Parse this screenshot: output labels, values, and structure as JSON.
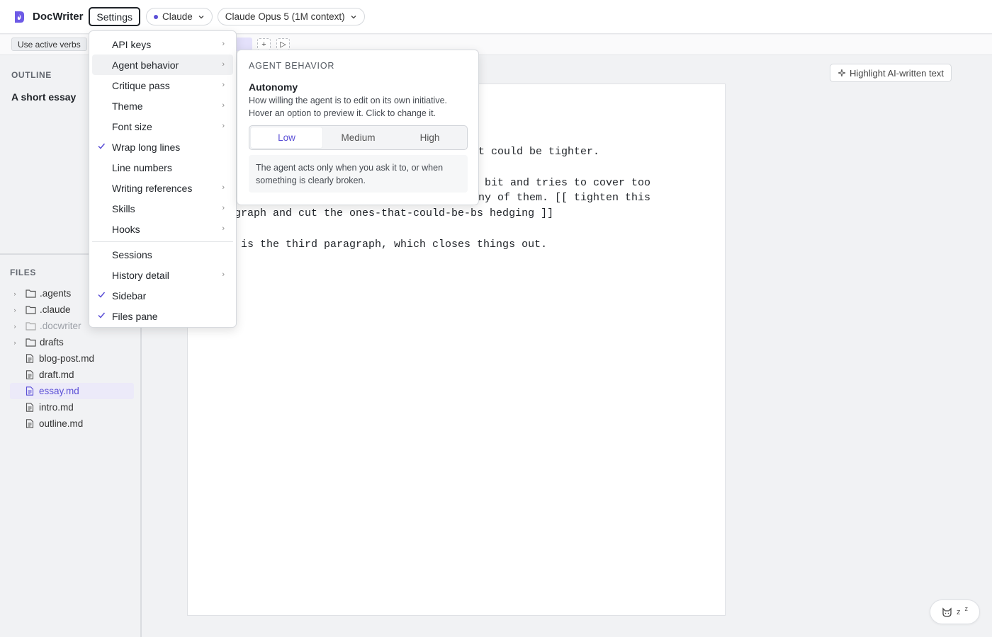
{
  "header": {
    "app_title": "DocWriter",
    "settings_label": "Settings",
    "provider_label": "Claude",
    "model_label": "Claude Opus 5 (1M context)"
  },
  "toolbar": {
    "chip_label": "Use active verbs",
    "add_label": "+",
    "play_label": "▷"
  },
  "sidebar": {
    "outline_label": "OUTLINE",
    "outline_item": "A short essay",
    "files_label": "FILES",
    "files": [
      {
        "name": ".agents",
        "type": "folder"
      },
      {
        "name": ".claude",
        "type": "folder"
      },
      {
        "name": ".docwriter",
        "type": "folder"
      },
      {
        "name": "drafts",
        "type": "folder"
      },
      {
        "name": "blog-post.md",
        "type": "file"
      },
      {
        "name": "draft.md",
        "type": "file"
      },
      {
        "name": "essay.md",
        "type": "file"
      },
      {
        "name": "intro.md",
        "type": "file"
      },
      {
        "name": "outline.md",
        "type": "file"
      }
    ]
  },
  "main": {
    "highlight_label": "Highlight AI-written text",
    "lines": [
      "t could be tighter.",
      " bit and tries to cover too",
      "ny of them. [[ tighten this",
      "graph and cut the ones-that-could-be-bs hedging ]]",
      " is the third paragraph, which closes things out."
    ],
    "sleep_label": "z",
    "sleep_label_small": "z"
  },
  "menu": {
    "items": [
      {
        "label": "API keys"
      },
      {
        "label": "Agent behavior"
      },
      {
        "label": "Critique pass"
      },
      {
        "label": "Theme"
      },
      {
        "label": "Font size"
      },
      {
        "label": "Wrap long lines"
      },
      {
        "label": "Line numbers"
      },
      {
        "label": "Writing references"
      },
      {
        "label": "Skills"
      },
      {
        "label": "Hooks"
      },
      {
        "label": "Sessions"
      },
      {
        "label": "History detail"
      },
      {
        "label": "Sidebar"
      },
      {
        "label": "Files pane"
      }
    ]
  },
  "panel": {
    "heading": "AGENT BEHAVIOR",
    "title": "Autonomy",
    "description": "How willing the agent is to edit on its own initiative. Hover an option to preview it. Click to change it.",
    "options": [
      "Low",
      "Medium",
      "High"
    ],
    "selected": "Low",
    "note": "The agent acts only when you ask it to, or when something is clearly broken."
  },
  "colors": {
    "accent": "#5b4fd6"
  }
}
